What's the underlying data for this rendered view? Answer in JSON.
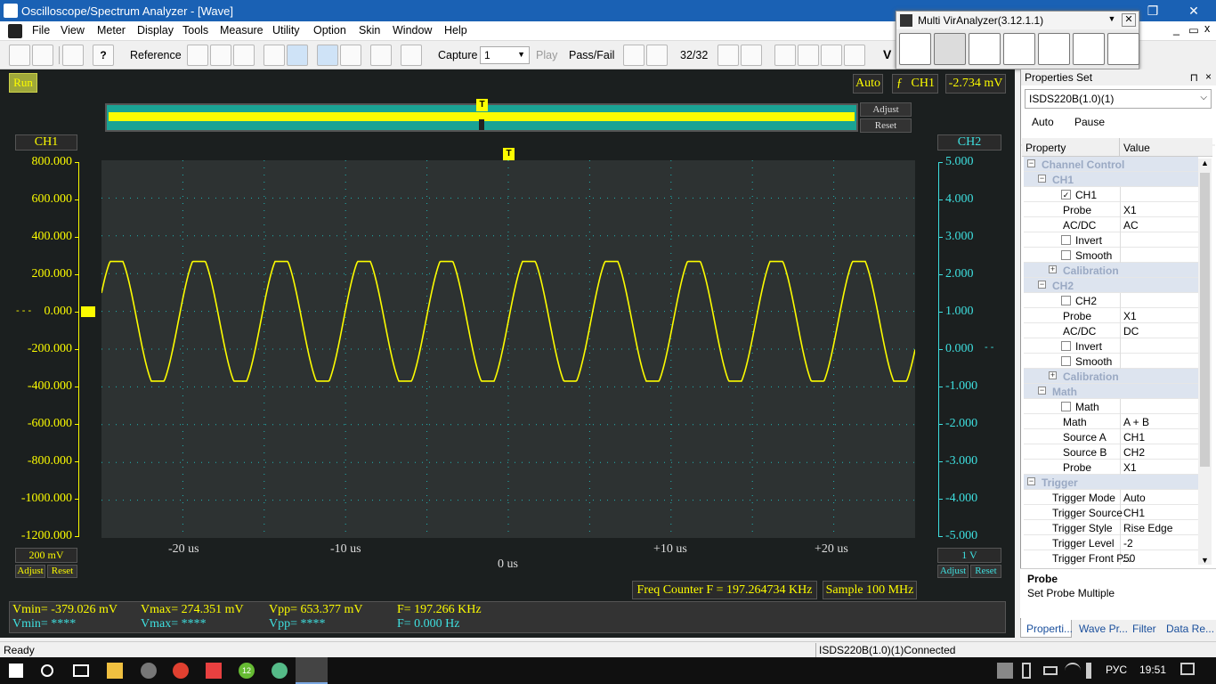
{
  "window": {
    "title": "Oscilloscope/Spectrum Analyzer - [Wave]",
    "restore_symbol": "❐",
    "close_symbol": "✕",
    "min_symbol": "—",
    "inner_min": "_",
    "inner_restore": "▭",
    "inner_close": "x"
  },
  "menu": [
    "File",
    "View",
    "Meter",
    "Display",
    "Tools",
    "Measure",
    "Utility",
    "Option",
    "Skin",
    "Window",
    "Help"
  ],
  "toolbar": {
    "reference_label": "Reference",
    "capture_label": "Capture",
    "capture_value": "1",
    "play_label": "Play",
    "passfail_label": "Pass/Fail",
    "frame_counter": "32/32",
    "v_label": "V"
  },
  "multi_analyzer": {
    "title": "Multi VirAnalyzer(3.12.1.1)"
  },
  "scope": {
    "run_label": "Run",
    "trigger_mode": "Auto",
    "trigger_source": "CH1",
    "trigger_level": "-2.734 mV",
    "adjust_label": "Adjust",
    "reset_label": "Reset",
    "trigger_marker": "T",
    "ch1_label": "CH1",
    "ch2_label": "CH2",
    "ch1_scale": "200 mV",
    "ch2_scale": "1 V",
    "ch1_ticks": [
      "800.000",
      "600.000",
      "400.000",
      "200.000",
      "0.000",
      "-200.000",
      "-400.000",
      "-600.000",
      "-800.000",
      "-1000.000",
      "-1200.000"
    ],
    "ch2_ticks": [
      "5.000",
      "4.000",
      "3.000",
      "2.000",
      "1.000",
      "0.000",
      "-1.000",
      "-2.000",
      "-3.000",
      "-4.000",
      "-5.000"
    ],
    "x_ticks": [
      "-20 us",
      "-10 us",
      "+10 us",
      "+20 us"
    ],
    "x_center": "0 us",
    "freq_counter": "Freq Counter F = 197.264734 KHz",
    "sample": "Sample 100 MHz",
    "ch1_marker_prefix": "- - -",
    "ch2_marker_prefix": "- -"
  },
  "measurements": {
    "ch1": {
      "vmin": "Vmin= -379.026 mV",
      "vmax": "Vmax= 274.351 mV",
      "vpp": "Vpp= 653.377 mV",
      "f": "F= 197.266 KHz"
    },
    "ch2": {
      "vmin": "Vmin= ****",
      "vmax": "Vmax= ****",
      "vpp": "Vpp= ****",
      "f": "F= 0.000 Hz"
    }
  },
  "properties": {
    "panel_title": "Properties Set",
    "pin_symbol": "⊓",
    "close_symbol": "×",
    "device": "ISDS220B(1.0)(1)",
    "auto_label": "Auto",
    "pause_label": "Pause",
    "col_property": "Property",
    "col_value": "Value",
    "rows": [
      {
        "type": "cat",
        "level": 0,
        "key": "Channel Control"
      },
      {
        "type": "cat",
        "level": 1,
        "key": "CH1"
      },
      {
        "type": "check",
        "level": 2,
        "key": "CH1",
        "checked": true,
        "value": ""
      },
      {
        "type": "prop",
        "level": 2,
        "key": "Probe",
        "value": "X1",
        "dropdown": true
      },
      {
        "type": "prop",
        "level": 2,
        "key": "AC/DC",
        "value": "AC"
      },
      {
        "type": "check",
        "level": 2,
        "key": "Invert",
        "checked": false,
        "value": ""
      },
      {
        "type": "check",
        "level": 2,
        "key": "Smooth",
        "checked": false,
        "value": ""
      },
      {
        "type": "sub",
        "level": 2,
        "key": "Calibration"
      },
      {
        "type": "cat",
        "level": 1,
        "key": "CH2"
      },
      {
        "type": "check",
        "level": 2,
        "key": "CH2",
        "checked": false,
        "value": ""
      },
      {
        "type": "prop",
        "level": 2,
        "key": "Probe",
        "value": "X1"
      },
      {
        "type": "prop",
        "level": 2,
        "key": "AC/DC",
        "value": "DC"
      },
      {
        "type": "check",
        "level": 2,
        "key": "Invert",
        "checked": false,
        "value": ""
      },
      {
        "type": "check",
        "level": 2,
        "key": "Smooth",
        "checked": false,
        "value": ""
      },
      {
        "type": "sub",
        "level": 2,
        "key": "Calibration"
      },
      {
        "type": "cat",
        "level": 1,
        "key": "Math"
      },
      {
        "type": "check",
        "level": 2,
        "key": "Math",
        "checked": false,
        "value": ""
      },
      {
        "type": "prop",
        "level": 2,
        "key": "Math",
        "value": "A + B"
      },
      {
        "type": "prop",
        "level": 2,
        "key": "Source A",
        "value": "CH1"
      },
      {
        "type": "prop",
        "level": 2,
        "key": "Source B",
        "value": "CH2"
      },
      {
        "type": "prop",
        "level": 2,
        "key": "Probe",
        "value": "X1"
      },
      {
        "type": "cat",
        "level": 0,
        "key": "Trigger"
      },
      {
        "type": "prop",
        "level": 1,
        "key": "Trigger Mode",
        "value": "Auto"
      },
      {
        "type": "prop",
        "level": 1,
        "key": "Trigger Source",
        "value": "CH1"
      },
      {
        "type": "prop",
        "level": 1,
        "key": "Trigger Style",
        "value": "Rise Edge"
      },
      {
        "type": "prop",
        "level": 1,
        "key": "Trigger Level",
        "value": "-2"
      },
      {
        "type": "prop",
        "level": 1,
        "key": "Trigger Front P...",
        "value": "50"
      }
    ],
    "desc_title": "Probe",
    "desc_text": "Set Probe Multiple",
    "tabs": [
      "Properti...",
      "Wave Pr...",
      "Filter",
      "Data Re..."
    ]
  },
  "status": {
    "left": "Ready",
    "right": "ISDS220B(1.0)(1)Connected"
  },
  "taskbar": {
    "lang": "РУС",
    "time": "19:51",
    "badge": "12"
  },
  "colors": {
    "ch1": "#fcfc00",
    "ch2": "#3ee0e0",
    "grid": "#1fb5b5",
    "plot_bg": "#2d3232"
  }
}
